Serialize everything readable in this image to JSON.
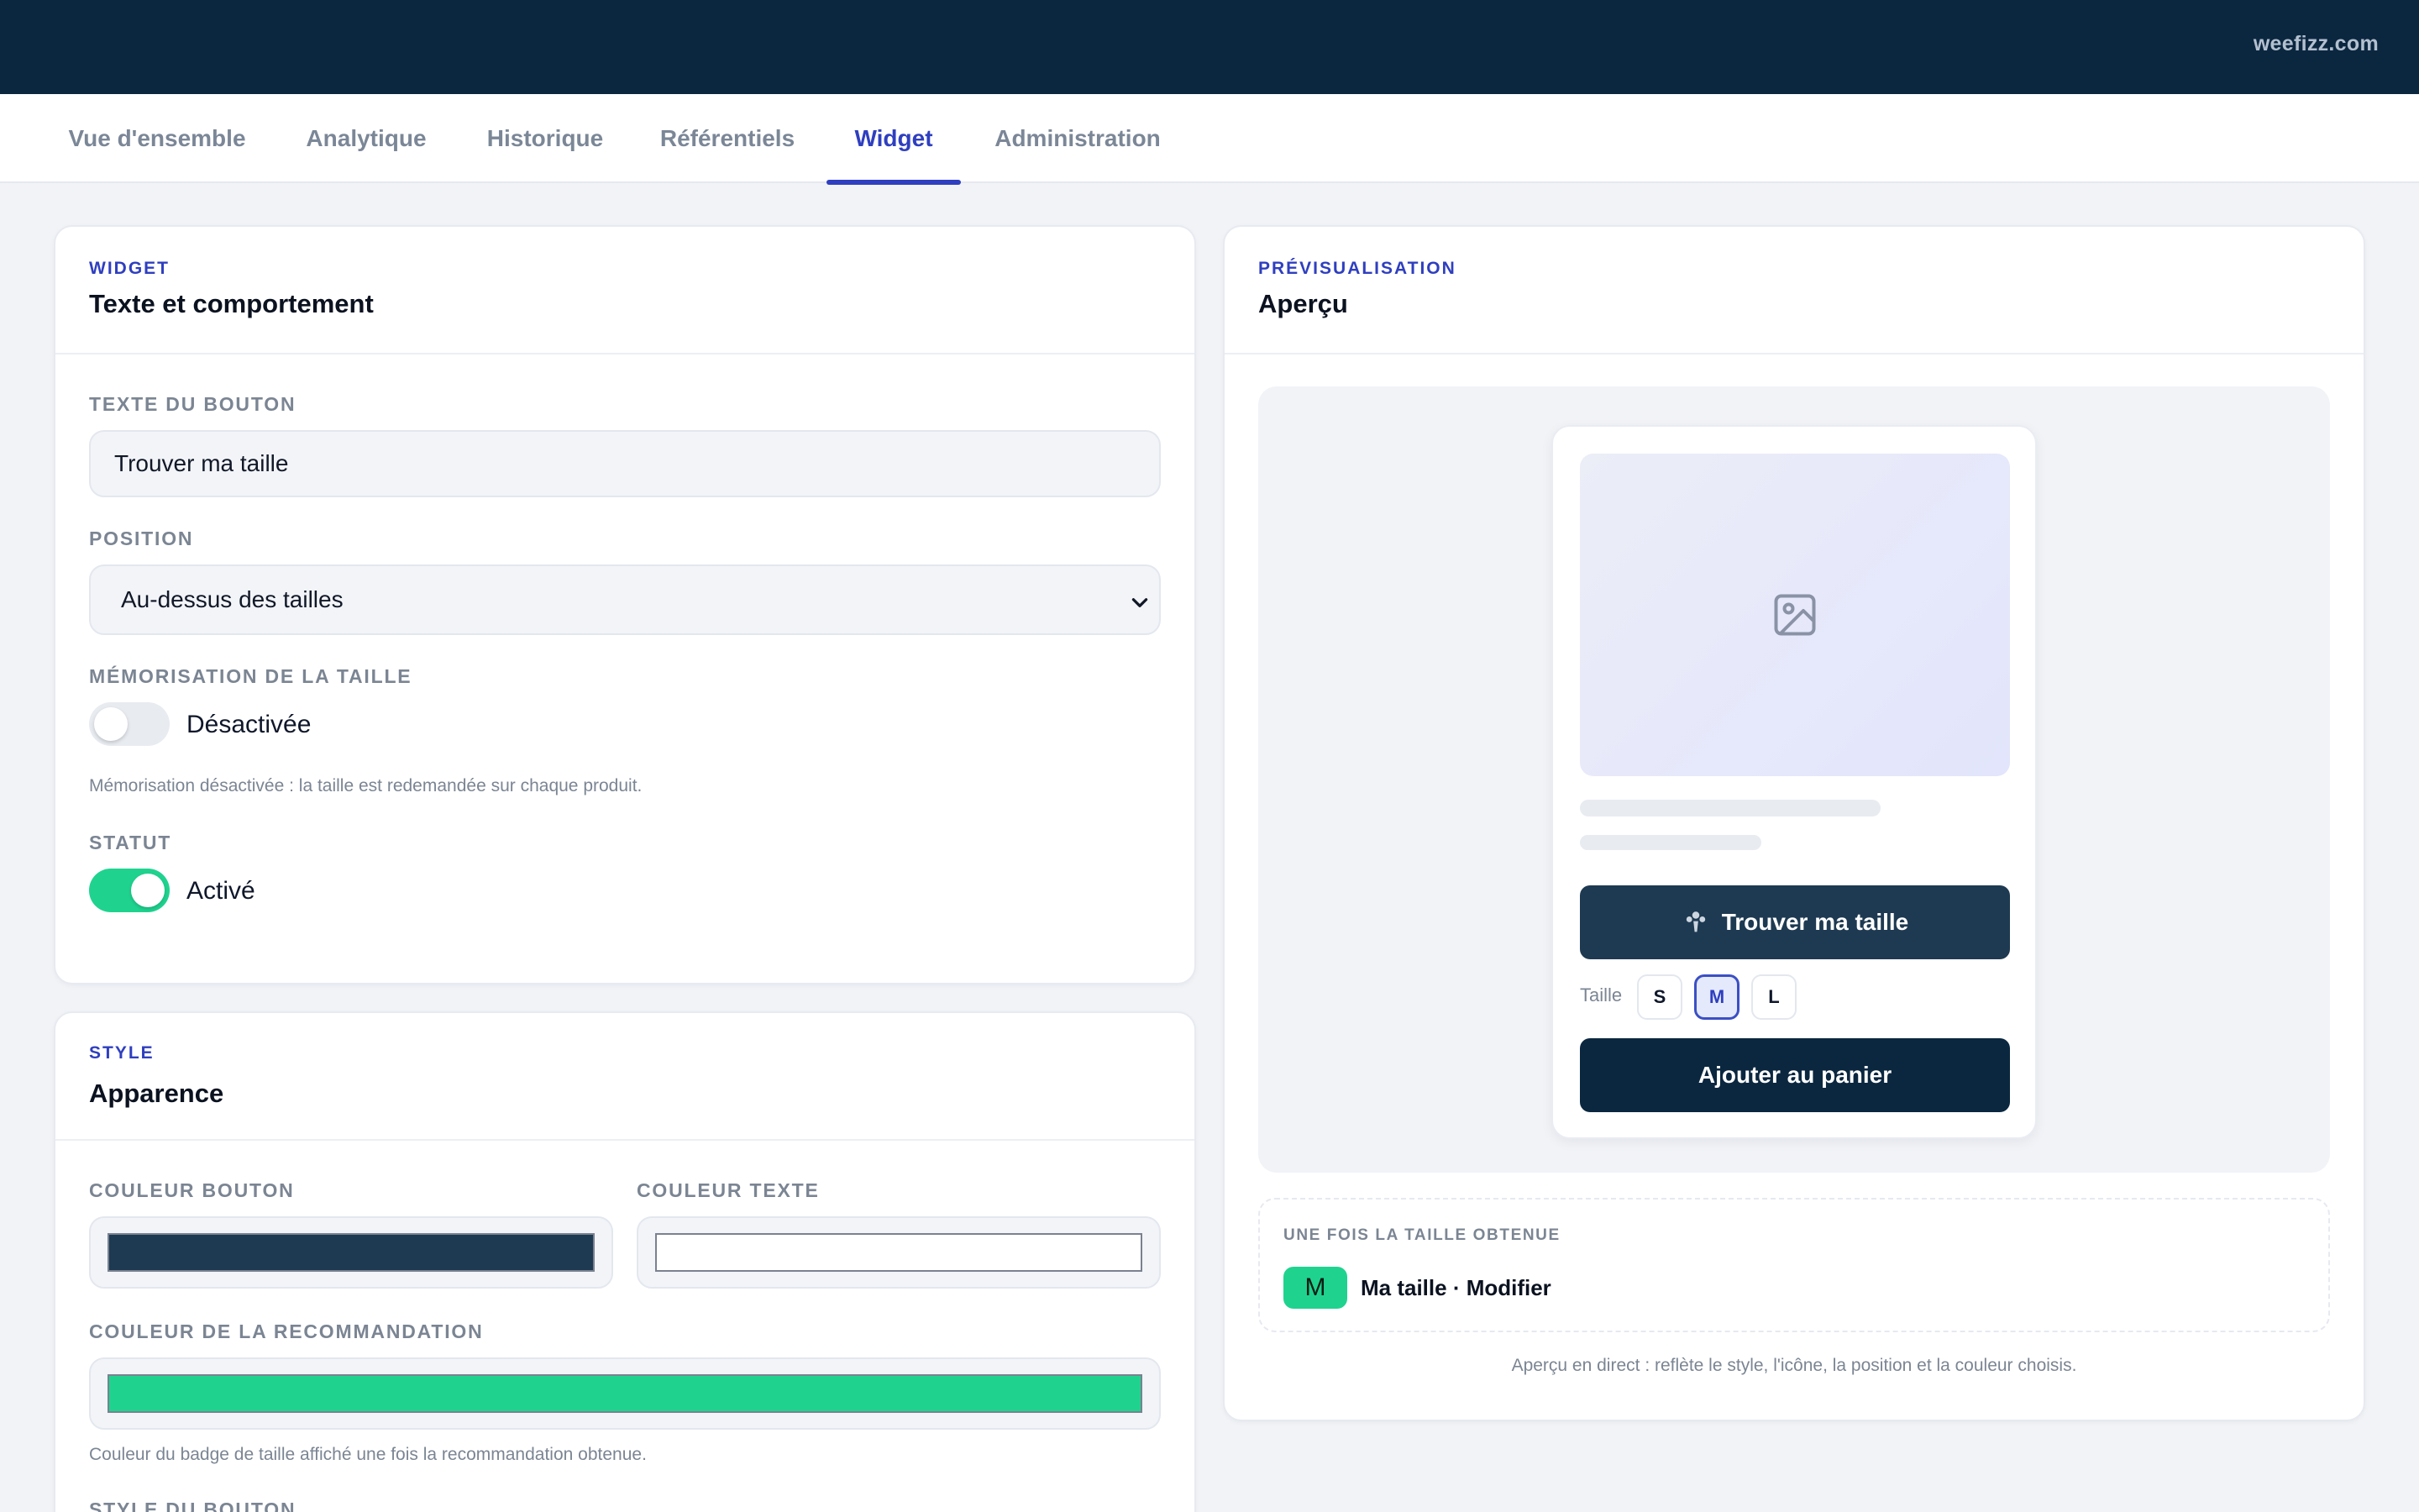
{
  "topbar": {
    "domain": "weefizz.com"
  },
  "nav": {
    "tabs": [
      {
        "label": "Vue d'ensemble"
      },
      {
        "label": "Analytique"
      },
      {
        "label": "Historique"
      },
      {
        "label": "Référentiels"
      },
      {
        "label": "Widget",
        "active": true
      },
      {
        "label": "Administration"
      }
    ]
  },
  "widget_card": {
    "eyebrow": "WIDGET",
    "title": "Texte et comportement",
    "button_text": {
      "label": "TEXTE DU BOUTON",
      "value": "Trouver ma taille"
    },
    "position": {
      "label": "POSITION",
      "value": "Au-dessus des tailles"
    },
    "memorisation": {
      "label": "MÉMORISATION DE LA TAILLE",
      "state": "Désactivée",
      "enabled": false,
      "hint": "Mémorisation désactivée : la taille est redemandée sur chaque produit."
    },
    "statut": {
      "label": "STATUT",
      "state": "Activé",
      "enabled": true
    }
  },
  "style_card": {
    "eyebrow": "STYLE",
    "title": "Apparence",
    "couleur_bouton": {
      "label": "COULEUR BOUTON",
      "color": "#1e3a52"
    },
    "couleur_texte": {
      "label": "COULEUR TEXTE",
      "color": "#ffffff"
    },
    "couleur_recommandation": {
      "label": "COULEUR DE LA RECOMMANDATION",
      "color": "#1fd38f",
      "hint": "Couleur du badge de taille affiché une fois la recommandation obtenue."
    },
    "style_bouton": {
      "label": "STYLE DU BOUTON"
    }
  },
  "preview_card": {
    "eyebrow": "PRÉVISUALISATION",
    "title": "Aperçu",
    "image_icon": "image-icon",
    "find_button": {
      "label": "Trouver ma taille",
      "icon": "weefizz-logo-icon"
    },
    "size_label": "Taille",
    "sizes": [
      {
        "label": "S",
        "selected": false
      },
      {
        "label": "M",
        "selected": true
      },
      {
        "label": "L",
        "selected": false
      }
    ],
    "cart_button": "Ajouter au panier",
    "after": {
      "eyebrow": "UNE FOIS LA TAILLE OBTENUE",
      "badge": "M",
      "text": "Ma taille · Modifier"
    },
    "note": "Aperçu en direct : reflète le style, l'icône, la position et la couleur choisis."
  },
  "colors": {
    "topbar": "#0b2740",
    "accent": "#2f3fbf",
    "success": "#1fd38f"
  }
}
